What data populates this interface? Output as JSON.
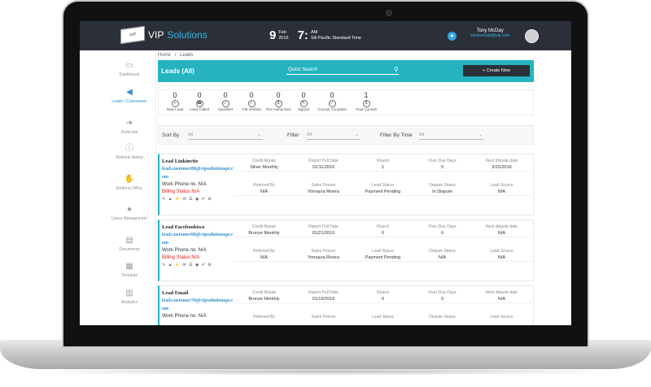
{
  "app": {
    "brand_vip": "VIP",
    "brand_solutions": " Solutions",
    "logo_text": "VIP SOLUTIONS"
  },
  "clock": {
    "day": "9",
    "month": "Feb",
    "year": "2016",
    "hour": "7:",
    "ampm": "AM",
    "tz": "SA Pacific Standard Time"
  },
  "user": {
    "name": "Tony McDay",
    "email": "solutionsvip@vip.com"
  },
  "breadcrumb": {
    "home": "Home",
    "sep": "/",
    "current": "Leads"
  },
  "header": {
    "title": "Leads (All)",
    "search_placeholder": "Quick Search",
    "create_label": "Create New",
    "create_icon": "+"
  },
  "sidebar": {
    "items": [
      {
        "label": "Dashboard",
        "icon": "monitor-icon"
      },
      {
        "label": "Leads / Consumers",
        "icon": "megaphone-icon"
      },
      {
        "label": "Referrals",
        "icon": "arrow-icon"
      },
      {
        "label": "Referral Status",
        "icon": "info-icon"
      },
      {
        "label": "Referral Office",
        "icon": "handshake-icon"
      },
      {
        "label": "Users Management",
        "icon": "user-icon"
      },
      {
        "label": "Documents",
        "icon": "document-icon"
      },
      {
        "label": "Template",
        "icon": "template-icon"
      },
      {
        "label": "Analytics",
        "icon": "chart-icon"
      }
    ]
  },
  "stats": [
    {
      "count": "0",
      "label": "New Lead"
    },
    {
      "count": "0",
      "label": "Lead Called"
    },
    {
      "count": "0",
      "label": "Qualified"
    },
    {
      "count": "0",
      "label": "CM Verified"
    },
    {
      "count": "0",
      "label": "Pre-Authorized"
    },
    {
      "count": "0",
      "label": "Signed"
    },
    {
      "count": "0",
      "label": "Consult Complete"
    },
    {
      "count": "1",
      "label": "Paid Consult"
    }
  ],
  "filters": {
    "sort_label": "Sort By",
    "sort_value": "All",
    "filter_label": "Filter",
    "filter_value": "All",
    "time_label": "Filter By Time",
    "time_value": "All"
  },
  "col_headers": {
    "credit_repair": "Credit Repair",
    "report_pull_date": "Report Pull Date",
    "round": "Round",
    "over_due_days": "Over Due Days",
    "next_dispute_date": "Next dispute date",
    "referred_by": "Referred By",
    "sales_person": "Sales Person",
    "lead_status": "Lead Status",
    "dispute_status": "Dispute Status",
    "lead_source": "Lead Source"
  },
  "leads": [
    {
      "name": "Lead Linkinvite",
      "email": "lead.customer88@vipsolutionspr.com",
      "phone": "Work Phone no. N/A",
      "billing": "Billing Status:N/A",
      "icons": "✎ ▲ ⚡ ✉ ☰ ◉ ✐ ⚙",
      "credit_repair": "Silver Monthly",
      "report_pull_date": "01/11/2016",
      "round": "1",
      "over_due_days": "0",
      "next_dispute_date": "3/15/2016",
      "referred_by": "N/A",
      "sales_person": "Yomayra Rivera",
      "lead_status": "Payment Pending",
      "dispute_status": "In Dispute",
      "lead_source": "N/A"
    },
    {
      "name": "Lead Facebooktwo",
      "email": "lead.customer60@vipsolutionspr.com",
      "phone": "Work Phone no. N/A",
      "billing": "Billing Status:N/A",
      "icons": "✎ ▲ ⚡ ✉ ☰ ◉ ✐ ⚙",
      "credit_repair": "Bronze Monthly",
      "report_pull_date": "01/21/2016",
      "round": "0",
      "over_due_days": "0",
      "next_dispute_date": "N/A",
      "referred_by": "N/A",
      "sales_person": "Yomayra Rivera",
      "lead_status": "Payment Pending",
      "dispute_status": "N/A",
      "lead_source": "N/A"
    },
    {
      "name": "Lead Email",
      "email": "lead.customer70@vipsolutionspr.com",
      "phone": "Work Phone no. N/A",
      "billing": "",
      "icons": "",
      "credit_repair": "Bronze Monthly",
      "report_pull_date": "01/19/2016",
      "round": "0",
      "over_due_days": "0",
      "next_dispute_date": "N/A",
      "referred_by": "",
      "sales_person": "",
      "lead_status": "",
      "dispute_status": "",
      "lead_source": ""
    }
  ]
}
